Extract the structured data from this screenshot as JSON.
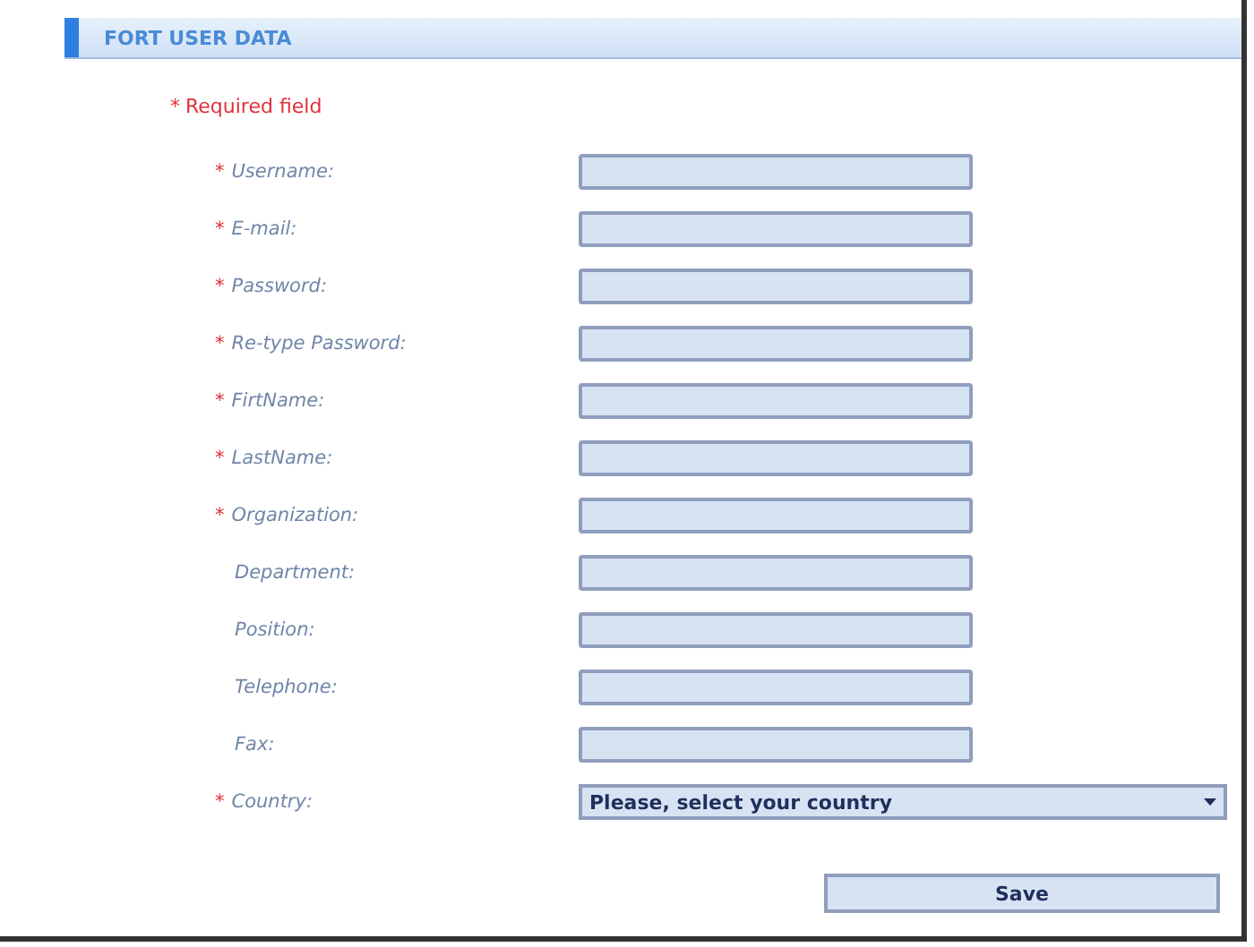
{
  "header": {
    "title": "FORT USER DATA"
  },
  "legend": {
    "mark": "*",
    "text": "Required field"
  },
  "fields": [
    {
      "kind": "text",
      "label": "Username:",
      "mark": "*"
    },
    {
      "kind": "text",
      "label": "E-mail:",
      "mark": "*"
    },
    {
      "kind": "text",
      "label": "Password:",
      "mark": "*"
    },
    {
      "kind": "text",
      "label": "Re-type Password:",
      "mark": "*"
    },
    {
      "kind": "text",
      "label": "FirtName:",
      "mark": "*"
    },
    {
      "kind": "text",
      "label": "LastName:",
      "mark": "*"
    },
    {
      "kind": "text",
      "label": "Organization:",
      "mark": "*"
    },
    {
      "kind": "text",
      "label": "Department:"
    },
    {
      "kind": "text",
      "label": "Position:"
    },
    {
      "kind": "text",
      "label": "Telephone:"
    },
    {
      "kind": "text",
      "label": "Fax:"
    },
    {
      "kind": "select",
      "label": "Country:",
      "mark": "*",
      "value": "Please, select your country"
    }
  ],
  "save_button": "Save"
}
